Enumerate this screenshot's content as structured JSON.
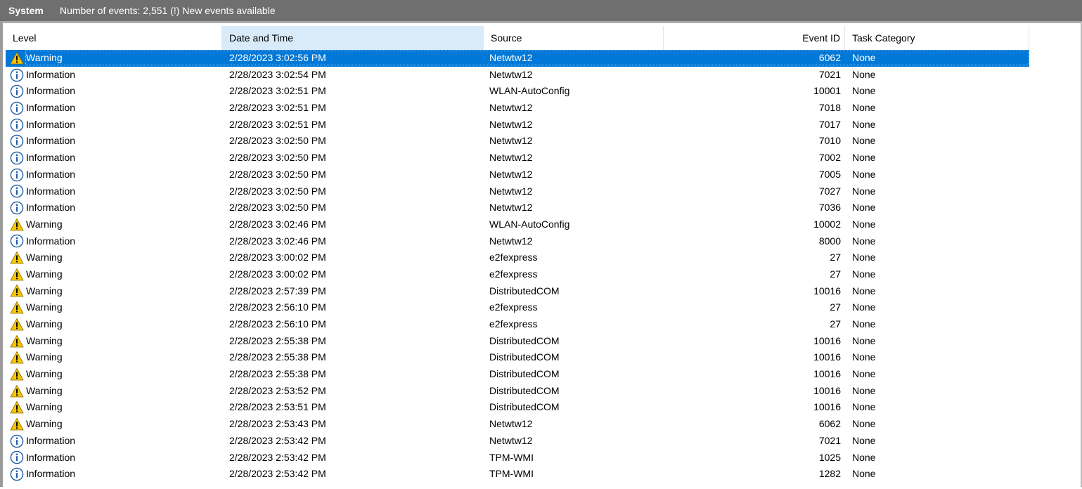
{
  "header": {
    "log_name": "System",
    "event_count_text": "Number of events: 2,551 (!) New events available"
  },
  "columns": {
    "level": "Level",
    "date_time": "Date and Time",
    "source": "Source",
    "event_id": "Event ID",
    "task_category": "Task Category"
  },
  "colors": {
    "selected_row": "#0078d7",
    "sorted_column": "#d9ebf9",
    "titlebar": "#6f6f6f",
    "warning_icon": "#f7c600",
    "info_icon": "#1f5fa8"
  },
  "rows": [
    {
      "level": "Warning",
      "icon": "warning-icon",
      "date": "2/28/2023 3:02:56 PM",
      "source": "Netwtw12",
      "event_id": "6062",
      "category": "None",
      "selected": true
    },
    {
      "level": "Information",
      "icon": "information-icon",
      "date": "2/28/2023 3:02:54 PM",
      "source": "Netwtw12",
      "event_id": "7021",
      "category": "None"
    },
    {
      "level": "Information",
      "icon": "information-icon",
      "date": "2/28/2023 3:02:51 PM",
      "source": "WLAN-AutoConfig",
      "event_id": "10001",
      "category": "None"
    },
    {
      "level": "Information",
      "icon": "information-icon",
      "date": "2/28/2023 3:02:51 PM",
      "source": "Netwtw12",
      "event_id": "7018",
      "category": "None"
    },
    {
      "level": "Information",
      "icon": "information-icon",
      "date": "2/28/2023 3:02:51 PM",
      "source": "Netwtw12",
      "event_id": "7017",
      "category": "None"
    },
    {
      "level": "Information",
      "icon": "information-icon",
      "date": "2/28/2023 3:02:50 PM",
      "source": "Netwtw12",
      "event_id": "7010",
      "category": "None"
    },
    {
      "level": "Information",
      "icon": "information-icon",
      "date": "2/28/2023 3:02:50 PM",
      "source": "Netwtw12",
      "event_id": "7002",
      "category": "None"
    },
    {
      "level": "Information",
      "icon": "information-icon",
      "date": "2/28/2023 3:02:50 PM",
      "source": "Netwtw12",
      "event_id": "7005",
      "category": "None"
    },
    {
      "level": "Information",
      "icon": "information-icon",
      "date": "2/28/2023 3:02:50 PM",
      "source": "Netwtw12",
      "event_id": "7027",
      "category": "None"
    },
    {
      "level": "Information",
      "icon": "information-icon",
      "date": "2/28/2023 3:02:50 PM",
      "source": "Netwtw12",
      "event_id": "7036",
      "category": "None"
    },
    {
      "level": "Warning",
      "icon": "warning-icon",
      "date": "2/28/2023 3:02:46 PM",
      "source": "WLAN-AutoConfig",
      "event_id": "10002",
      "category": "None"
    },
    {
      "level": "Information",
      "icon": "information-icon",
      "date": "2/28/2023 3:02:46 PM",
      "source": "Netwtw12",
      "event_id": "8000",
      "category": "None"
    },
    {
      "level": "Warning",
      "icon": "warning-icon",
      "date": "2/28/2023 3:00:02 PM",
      "source": "e2fexpress",
      "event_id": "27",
      "category": "None"
    },
    {
      "level": "Warning",
      "icon": "warning-icon",
      "date": "2/28/2023 3:00:02 PM",
      "source": "e2fexpress",
      "event_id": "27",
      "category": "None"
    },
    {
      "level": "Warning",
      "icon": "warning-icon",
      "date": "2/28/2023 2:57:39 PM",
      "source": "DistributedCOM",
      "event_id": "10016",
      "category": "None"
    },
    {
      "level": "Warning",
      "icon": "warning-icon",
      "date": "2/28/2023 2:56:10 PM",
      "source": "e2fexpress",
      "event_id": "27",
      "category": "None"
    },
    {
      "level": "Warning",
      "icon": "warning-icon",
      "date": "2/28/2023 2:56:10 PM",
      "source": "e2fexpress",
      "event_id": "27",
      "category": "None"
    },
    {
      "level": "Warning",
      "icon": "warning-icon",
      "date": "2/28/2023 2:55:38 PM",
      "source": "DistributedCOM",
      "event_id": "10016",
      "category": "None"
    },
    {
      "level": "Warning",
      "icon": "warning-icon",
      "date": "2/28/2023 2:55:38 PM",
      "source": "DistributedCOM",
      "event_id": "10016",
      "category": "None"
    },
    {
      "level": "Warning",
      "icon": "warning-icon",
      "date": "2/28/2023 2:55:38 PM",
      "source": "DistributedCOM",
      "event_id": "10016",
      "category": "None"
    },
    {
      "level": "Warning",
      "icon": "warning-icon",
      "date": "2/28/2023 2:53:52 PM",
      "source": "DistributedCOM",
      "event_id": "10016",
      "category": "None"
    },
    {
      "level": "Warning",
      "icon": "warning-icon",
      "date": "2/28/2023 2:53:51 PM",
      "source": "DistributedCOM",
      "event_id": "10016",
      "category": "None"
    },
    {
      "level": "Warning",
      "icon": "warning-icon",
      "date": "2/28/2023 2:53:43 PM",
      "source": "Netwtw12",
      "event_id": "6062",
      "category": "None"
    },
    {
      "level": "Information",
      "icon": "information-icon",
      "date": "2/28/2023 2:53:42 PM",
      "source": "Netwtw12",
      "event_id": "7021",
      "category": "None"
    },
    {
      "level": "Information",
      "icon": "information-icon",
      "date": "2/28/2023 2:53:42 PM",
      "source": "TPM-WMI",
      "event_id": "1025",
      "category": "None"
    },
    {
      "level": "Information",
      "icon": "information-icon",
      "date": "2/28/2023 2:53:42 PM",
      "source": "TPM-WMI",
      "event_id": "1282",
      "category": "None"
    }
  ]
}
